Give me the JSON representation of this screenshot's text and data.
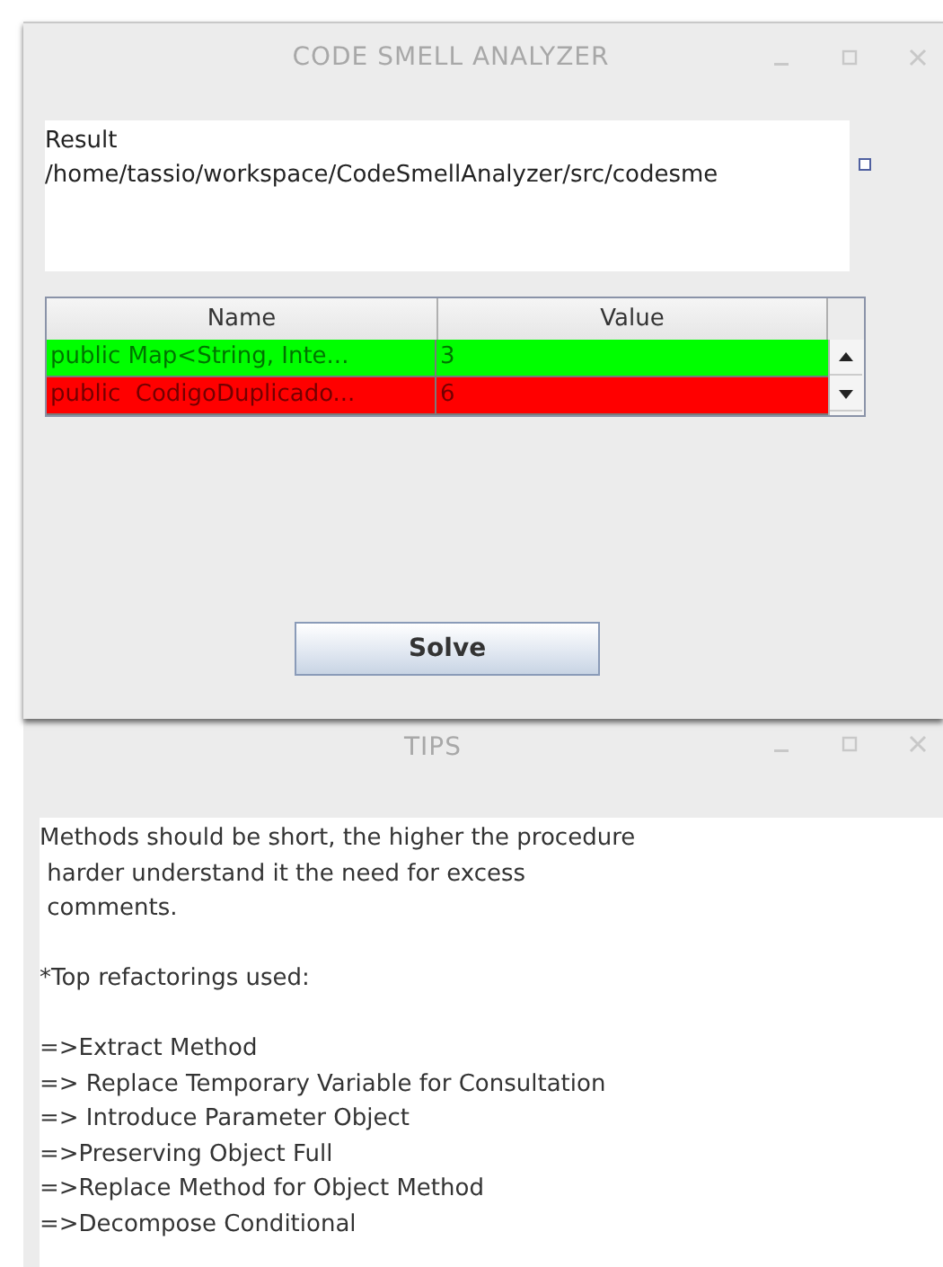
{
  "analyzer_window": {
    "title": "CODE SMELL ANALYZER",
    "result": {
      "label": "Result",
      "path": "/home/tassio/workspace/CodeSmellAnalyzer/src/codesme"
    },
    "table": {
      "columns": [
        "Name",
        "Value"
      ],
      "rows": [
        {
          "name": "public Map<String, Inte...",
          "value": "3",
          "color": "#00ff00"
        },
        {
          "name": "public  CodigoDuplicado...",
          "value": "6",
          "color": "#ff0000"
        }
      ]
    },
    "button": "Solve"
  },
  "tips_window": {
    "title": "TIPS",
    "description": [
      "Methods should be short, the higher the procedure",
      " harder understand it the need for excess",
      " comments."
    ],
    "heading": "*Top refactorings used:",
    "refactorings": [
      "=>Extract Method",
      "=> Replace Temporary Variable for Consultation",
      "=> Introduce Parameter Object",
      "=>Preserving Object Full",
      "=>Replace Method for Object Method",
      "=>Decompose Conditional"
    ]
  }
}
